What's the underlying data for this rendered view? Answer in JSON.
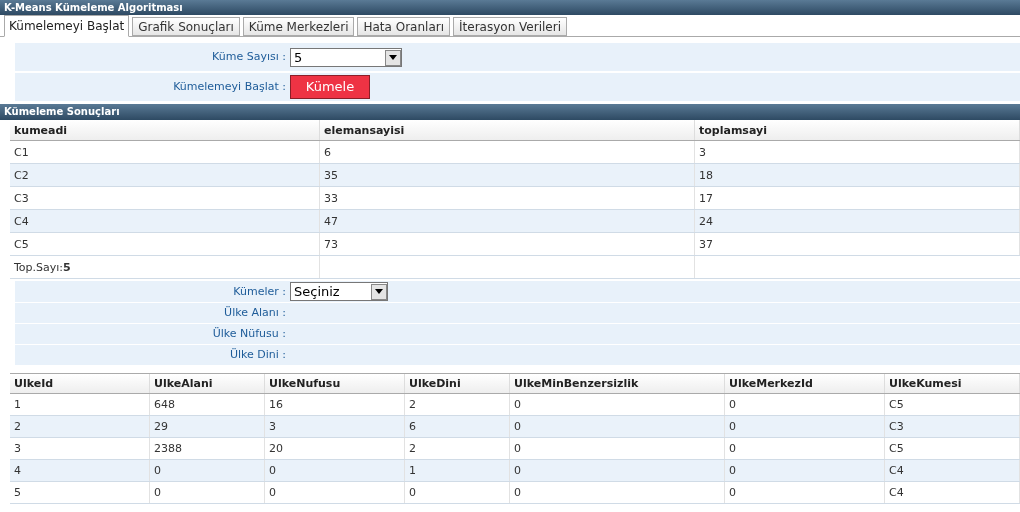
{
  "window": {
    "title": "K-Means Kümeleme Algoritması"
  },
  "tabs": [
    {
      "label": "Kümelemeyi Başlat",
      "selected": true
    },
    {
      "label": "Grafik Sonuçları",
      "selected": false
    },
    {
      "label": "Küme Merkezleri",
      "selected": false
    },
    {
      "label": "Hata Oranları",
      "selected": false
    },
    {
      "label": "İterasyon Verileri",
      "selected": false
    }
  ],
  "start_form": {
    "cluster_count_label": "Küme Sayısı :",
    "cluster_count_value": "5",
    "start_label": "Kümelemeyi Başlat :",
    "start_button": "Kümele"
  },
  "results": {
    "title": "Kümeleme Sonuçları",
    "columns": [
      "kumeadi",
      "elemansayisi",
      "toplamsayi"
    ],
    "rows": [
      [
        "C1",
        "6",
        "3"
      ],
      [
        "C2",
        "35",
        "18"
      ],
      [
        "C3",
        "33",
        "17"
      ],
      [
        "C4",
        "47",
        "24"
      ],
      [
        "C5",
        "73",
        "37"
      ]
    ],
    "footer_label": "Top.Sayı:",
    "footer_value": "5"
  },
  "country_form": {
    "clusters_label": "Kümeler :",
    "clusters_value": "Seçiniz",
    "fields": [
      "Ülke Alanı :",
      "Ülke Nüfusu :",
      "Ülke Dini :"
    ]
  },
  "countries": {
    "columns": [
      "UlkeId",
      "UlkeAlani",
      "UlkeNufusu",
      "UlkeDini",
      "UlkeMinBenzersizlik",
      "UlkeMerkezId",
      "UlkeKumesi"
    ],
    "rows": [
      [
        "1",
        "648",
        "16",
        "2",
        "0",
        "0",
        "C5"
      ],
      [
        "2",
        "29",
        "3",
        "6",
        "0",
        "0",
        "C3"
      ],
      [
        "3",
        "2388",
        "20",
        "2",
        "0",
        "0",
        "C5"
      ],
      [
        "4",
        "0",
        "0",
        "1",
        "0",
        "0",
        "C4"
      ],
      [
        "5",
        "0",
        "0",
        "0",
        "0",
        "0",
        "C4"
      ]
    ]
  }
}
